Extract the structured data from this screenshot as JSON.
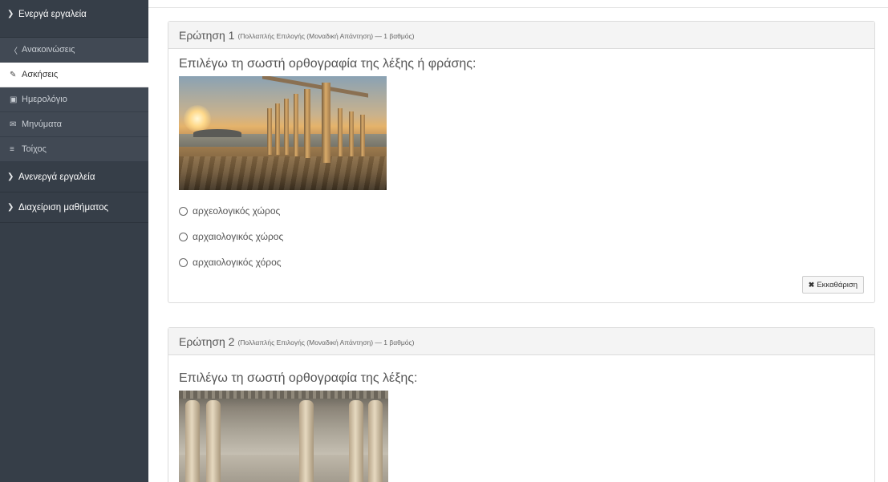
{
  "sidebar": {
    "active_tools": {
      "label": "Ενεργά εργαλεία",
      "icon": "chevron-down-icon"
    },
    "items": [
      {
        "label": "Ανακοινώσεις",
        "icon": "bullhorn-icon"
      },
      {
        "label": "Ασκήσεις",
        "icon": "edit-icon",
        "active": true
      },
      {
        "label": "Ημερολόγιο",
        "icon": "calendar-icon"
      },
      {
        "label": "Μηνύματα",
        "icon": "envelope-icon"
      },
      {
        "label": "Τοίχος",
        "icon": "list-icon"
      }
    ],
    "inactive_tools": {
      "label": "Ανενεργά εργαλεία",
      "icon": "chevron-right-icon"
    },
    "course_admin": {
      "label": "Διαχείριση μαθήματος",
      "icon": "chevron-right-icon"
    }
  },
  "questions": [
    {
      "title": "Ερώτηση 1",
      "meta": "(Πολλαπλής Επιλογής (Μοναδική Απάντηση) — 1 βαθμός)",
      "text": "Επιλέγω τη σωστή ορθογραφία της λέξης ή φράσης:",
      "image": "temple-of-poseidon-sunset",
      "options": [
        "αρχεολογικός χώρος",
        "αρχαιολογικός χώρος",
        "αρχαιολογικός χόρος"
      ],
      "clear_label": "Εκκαθάριση"
    },
    {
      "title": "Ερώτηση 2",
      "meta": "(Πολλαπλής Επιλογής (Μοναδική Απάντηση) — 1 βαθμός)",
      "text": "Επιλέγω τη σωστή ορθογραφία της λέξης:",
      "image": "caryatids-museum-display"
    }
  ],
  "colors": {
    "sidebar_bg": "#363e48",
    "sidebar_item_bg": "#414954",
    "panel_header_bg": "#f4f4f4",
    "panel_border": "#dcdcdc"
  }
}
